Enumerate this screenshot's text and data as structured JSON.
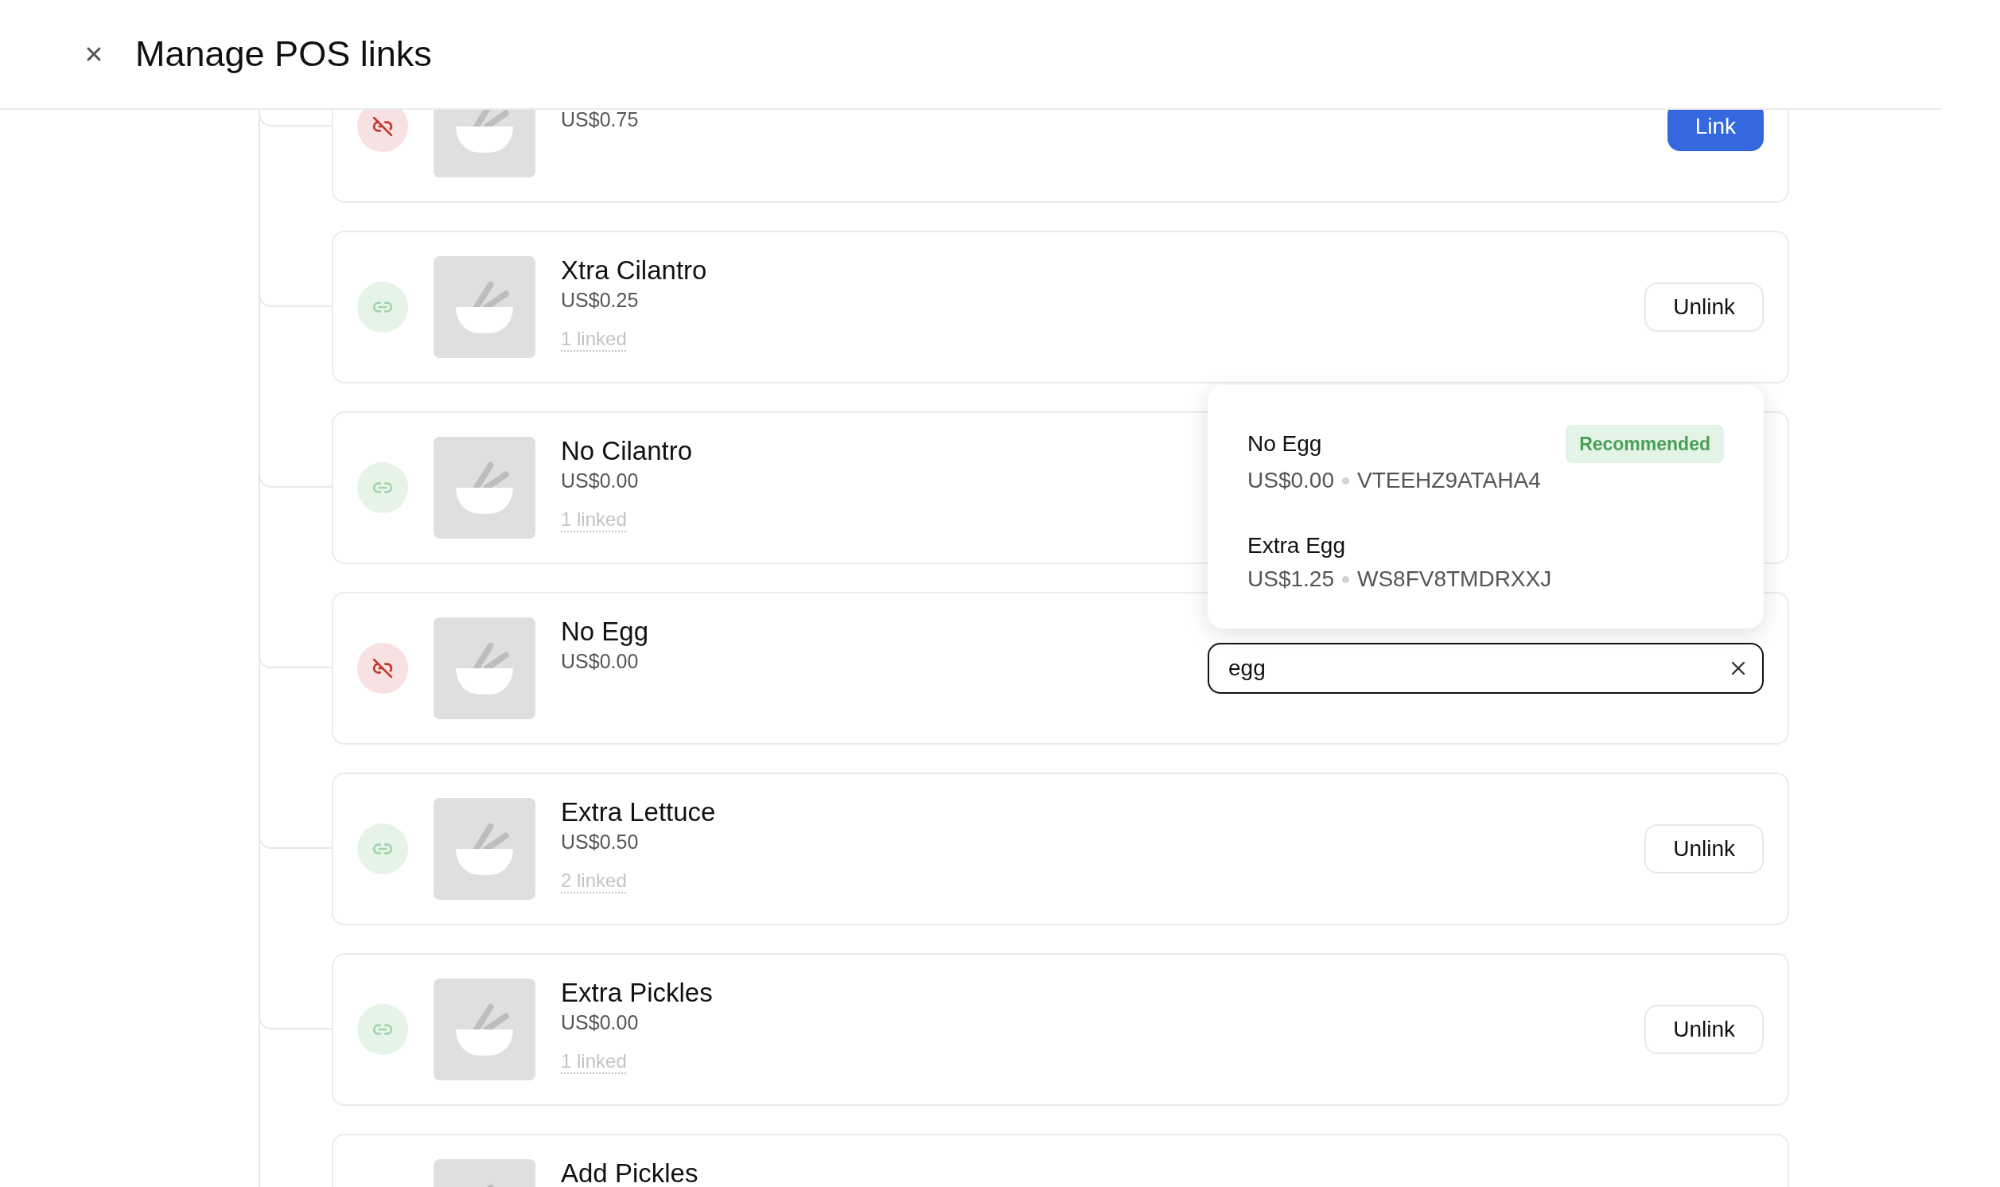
{
  "header": {
    "title": "Manage POS links"
  },
  "items": [
    {
      "price": "US$0.75",
      "linked": false,
      "action": {
        "kind": "primary",
        "label": "Link"
      }
    },
    {
      "name": "Xtra Cilantro",
      "price": "US$0.25",
      "linked": true,
      "link_count": "1 linked",
      "action": {
        "kind": "secondary",
        "label": "Unlink"
      }
    },
    {
      "name": "No Cilantro",
      "price": "US$0.00",
      "linked": true,
      "link_count": "1 linked"
    },
    {
      "name": "No Egg",
      "price": "US$0.00",
      "linked": false,
      "action": {
        "kind": "search",
        "value": "egg",
        "results": [
          {
            "name": "No Egg",
            "badge": "Recommended",
            "price": "US$0.00",
            "code": "VTEEHZ9ATAHA4"
          },
          {
            "name": "Extra Egg",
            "price": "US$1.25",
            "code": "WS8FV8TMDRXXJ"
          }
        ]
      }
    },
    {
      "name": "Extra Lettuce",
      "price": "US$0.50",
      "linked": true,
      "link_count": "2 linked",
      "action": {
        "kind": "secondary",
        "label": "Unlink"
      }
    },
    {
      "name": "Extra Pickles",
      "price": "US$0.00",
      "linked": true,
      "link_count": "1 linked",
      "action": {
        "kind": "secondary",
        "label": "Unlink"
      }
    },
    {
      "name": "Add Pickles"
    }
  ]
}
